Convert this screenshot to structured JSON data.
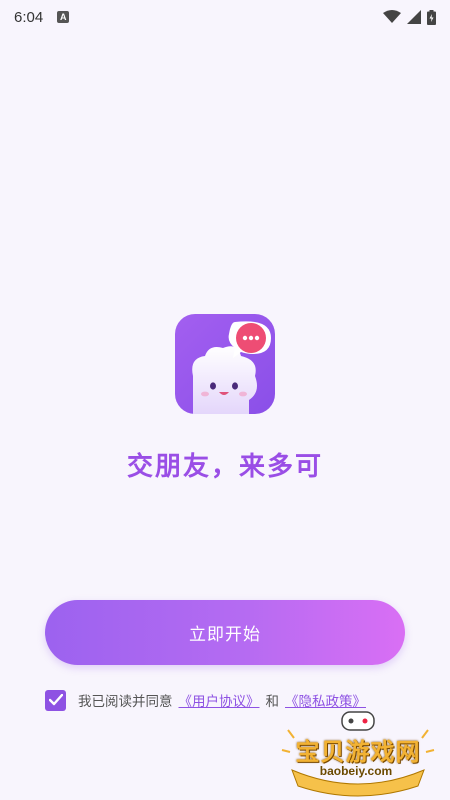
{
  "status_bar": {
    "time": "6:04",
    "notification_letter": "A"
  },
  "app_icon": {
    "name": "app-logo",
    "bubble_dots": "•••"
  },
  "slogan": "交朋友，来多可",
  "start_button": {
    "label": "立即开始"
  },
  "agreement": {
    "checked": true,
    "text": "我已阅读并同意",
    "user_agreement": "《用户协议》",
    "conjunction": "和",
    "privacy_policy": "《隐私政策》"
  },
  "watermark": {
    "title": "宝贝游戏网",
    "url": "baobeiy.com"
  },
  "colors": {
    "accent": "#9a4ee6",
    "button_gradient_start": "#9c62ef",
    "button_gradient_end": "#d96ff4",
    "background": "#f8f5fd"
  }
}
